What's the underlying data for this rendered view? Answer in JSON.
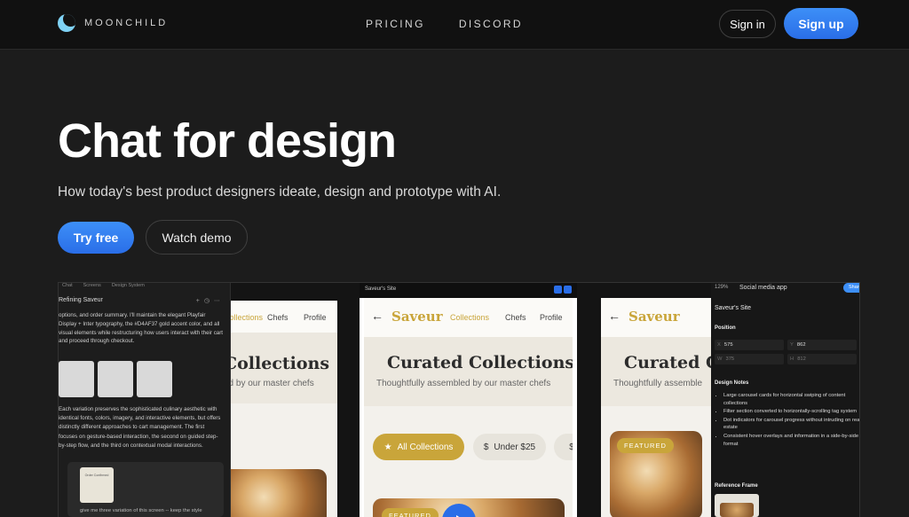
{
  "nav": {
    "brand": "MOONCHILD",
    "links": [
      "PRICING",
      "DISCORD"
    ],
    "signin": "Sign in",
    "signup": "Sign up"
  },
  "hero": {
    "title": "Chat for design",
    "subtitle": "How today's best product designers ideate, design and prototype with AI.",
    "try_free": "Try free",
    "watch_demo": "Watch demo"
  },
  "chat_panel": {
    "tabs": [
      "Chat",
      "Screens",
      "Design System"
    ],
    "heading": "Refining Saveur",
    "para1": "options, and order summary. I'll maintain the elegant Playfair Display + Inter typography, the #D4AF37 gold accent color, and all visual elements while restructuring how users interact with their cart and proceed through checkout.",
    "para2": "Each variation preserves the sophisticated culinary aesthetic with identical fonts, colors, imagery, and interactive elements, but offers distinctly different approaches to cart management. The first focuses on gesture-based interaction, the second on guided step-by-step flow, and the third on contextual modal interactions.",
    "card_title": "Order Confirmed",
    "input": "give me three variation of this screen -- keep the style"
  },
  "screen_a": {
    "links": [
      "Collections",
      "Chefs",
      "Profile"
    ],
    "title": "Collections",
    "subtitle": "ed by our master chefs"
  },
  "screen_b": {
    "window_title": "Saveur's Site",
    "brand": "Saveur",
    "links": [
      "Collections",
      "Chefs",
      "Profile"
    ],
    "title": "Curated Collections",
    "subtitle": "Thoughtfully assembled by our master chefs",
    "pills": [
      "All Collections",
      "Under $25"
    ],
    "badge": "FEATURED"
  },
  "screen_c": {
    "brand": "Saveur",
    "title": "Curated C",
    "subtitle": "Thoughtfully assemble",
    "badge": "FEATURED"
  },
  "inspector": {
    "zoom": "129%",
    "app": "Social media app",
    "share": "Share",
    "site": "Saveur's Site",
    "position_label": "Position",
    "x": "575",
    "y": "862",
    "w": "375",
    "h": "812",
    "notes_label": "Design Notes",
    "notes": [
      "Large carousel cards for horizontal swiping of content collections",
      "Filter section converted to horizontally-scrolling tag system",
      "Dot indicators for carousel progress without intruding on real estate",
      "Consistent hover overlays and information in a side-by-side format"
    ],
    "ref_label": "Reference Frame"
  },
  "colors": {
    "accent": "#2a6ee8",
    "gold": "#c9a53a",
    "background": "#1c1c1c"
  }
}
